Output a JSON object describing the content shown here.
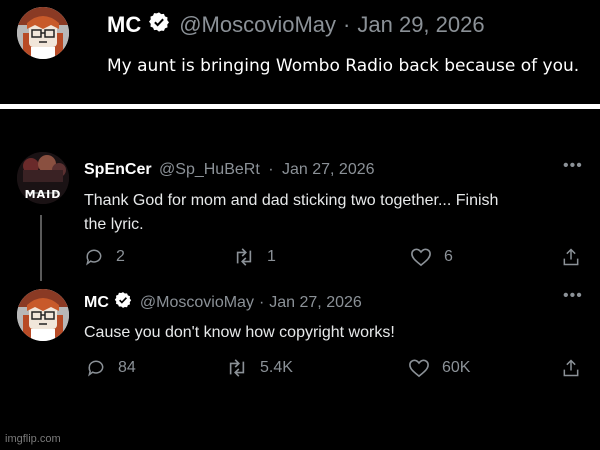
{
  "top_tweet": {
    "name": "MC",
    "handle": "@MoscovioMay",
    "separator": "·",
    "date": "Jan 29, 2026",
    "text": "My aunt is bringing Wombo Radio back because of you."
  },
  "thread": {
    "tweets": [
      {
        "name": "SpEnCer",
        "handle": "@Sp_HuBeRt",
        "separator": "·",
        "date": "Jan 27, 2026",
        "text_line1": "Thank God for mom and dad sticking two together... Finish",
        "text_line2": "the lyric.",
        "avatar_caption": "MAID",
        "more": "•••",
        "replies": "2",
        "retweets": "1",
        "likes": "6"
      },
      {
        "name": "MC",
        "handle": "@MoscovioMay",
        "separator": "·",
        "date": "Jan 27, 2026",
        "text": "Cause you don't know how copyright works!",
        "more": "•••",
        "replies": "84",
        "retweets": "5.4K",
        "likes": "60K"
      }
    ]
  },
  "watermark": "imgflip.com",
  "colors": {
    "background": "#000000",
    "text": "#e7e9ea",
    "muted": "#8b9197",
    "verified": "#ffffff",
    "divider": "#ffffff",
    "thread_line": "#5a5a5a"
  },
  "icons": [
    "reply-icon",
    "retweet-icon",
    "like-icon",
    "share-icon",
    "verified-icon",
    "more-icon"
  ]
}
